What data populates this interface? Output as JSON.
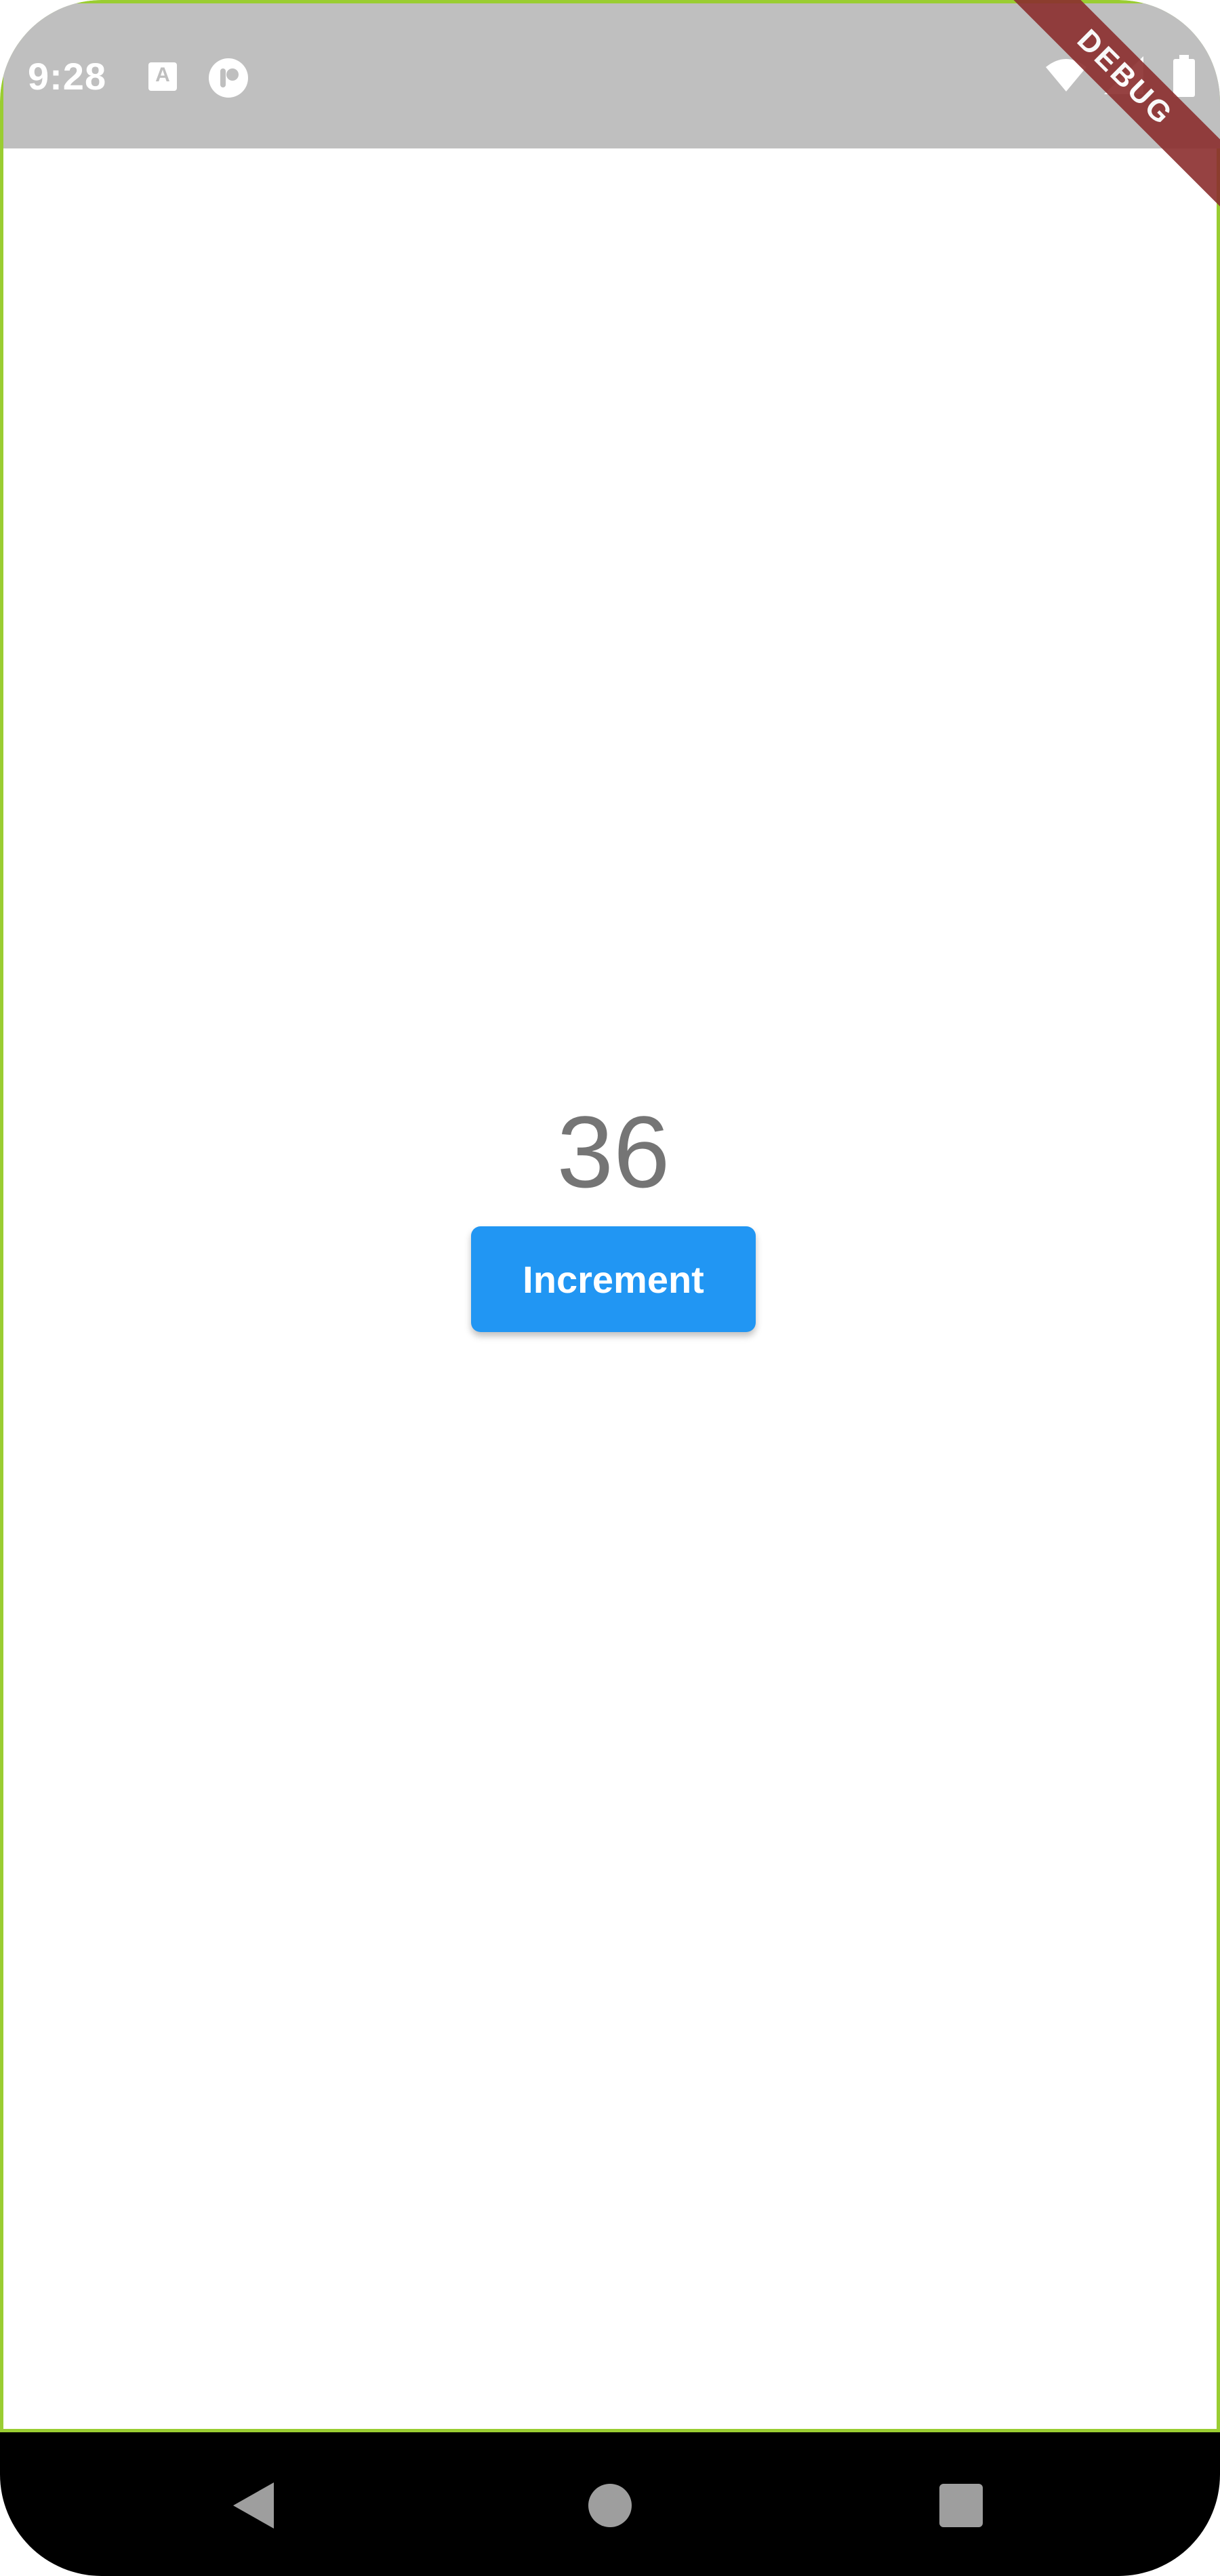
{
  "status_bar": {
    "time": "9:28",
    "notification_icon_label": "A",
    "icons": [
      "text-notification-icon",
      "play-protect-icon",
      "wifi-icon",
      "cell-signal-icon",
      "battery-icon"
    ]
  },
  "debug_banner": {
    "label": "DEBUG",
    "color": "#8b2e2e"
  },
  "main": {
    "counter_value": "36",
    "increment_label": "Increment",
    "button_color": "#2196f3"
  },
  "nav_bar": {
    "buttons": [
      "back-icon",
      "home-icon",
      "recents-icon"
    ]
  }
}
